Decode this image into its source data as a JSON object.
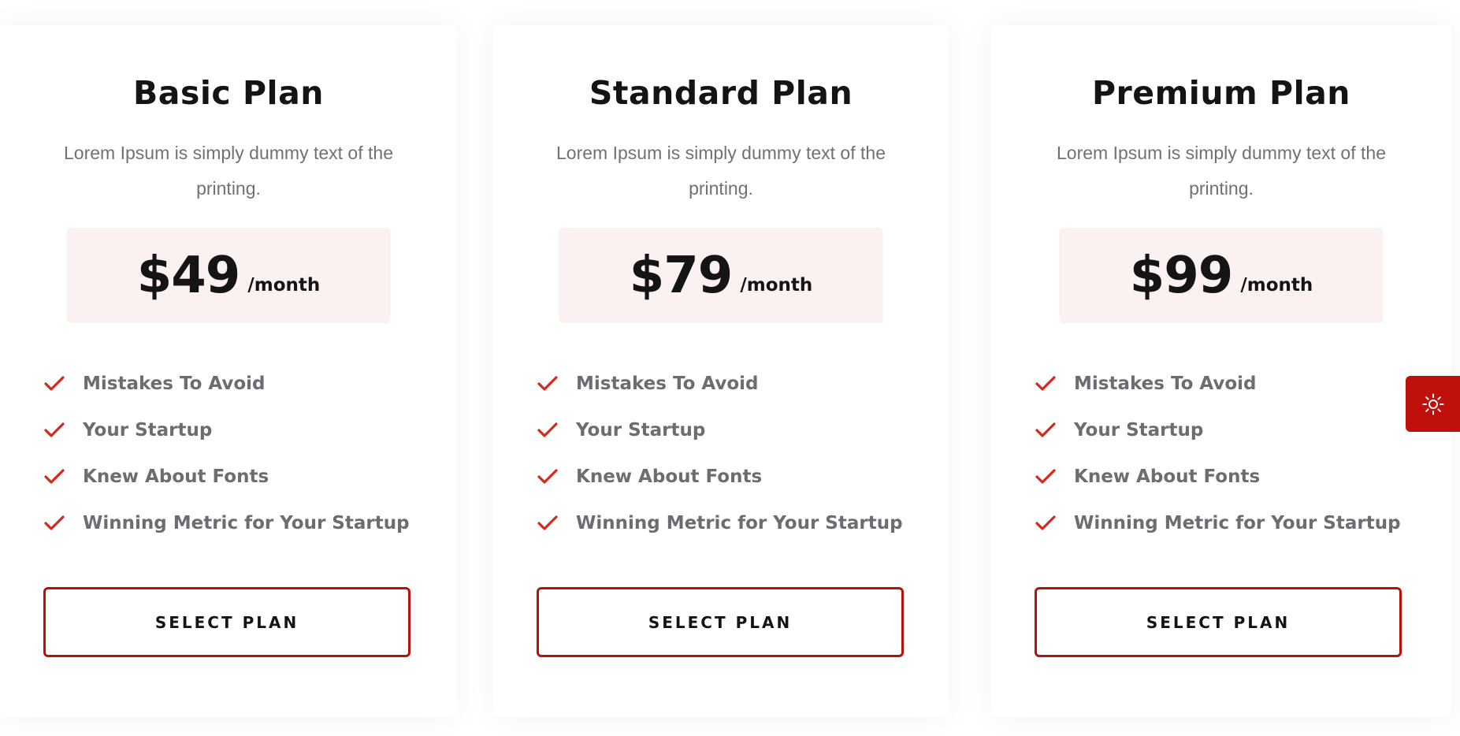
{
  "plans": [
    {
      "title": "Basic Plan",
      "description": "Lorem Ipsum is simply dummy text of the printing.",
      "price": "$49",
      "period": "/month",
      "features": [
        "Mistakes To Avoid",
        "Your Startup",
        "Knew About Fonts",
        "Winning Metric for Your Startup"
      ],
      "button_label": "SELECT PLAN"
    },
    {
      "title": "Standard Plan",
      "description": "Lorem Ipsum is simply dummy text of the printing.",
      "price": "$79",
      "period": "/month",
      "features": [
        "Mistakes To Avoid",
        "Your Startup",
        "Knew About Fonts",
        "Winning Metric for Your Startup"
      ],
      "button_label": "SELECT PLAN"
    },
    {
      "title": "Premium Plan",
      "description": "Lorem Ipsum is simply dummy text of the printing.",
      "price": "$99",
      "period": "/month",
      "features": [
        "Mistakes To Avoid",
        "Your Startup",
        "Knew About Fonts",
        "Winning Metric for Your Startup"
      ],
      "button_label": "SELECT PLAN"
    }
  ],
  "icons": {
    "feature_check": "check-icon",
    "theme_toggle": "sun-icon"
  },
  "colors": {
    "accent": "#b5120b",
    "check": "#d42a1e",
    "toggle_bg": "#c0100b",
    "price_bg": "#faf1f0",
    "title": "#141414",
    "muted_text": "#6f7176",
    "feature_text": "#6b6d72"
  }
}
